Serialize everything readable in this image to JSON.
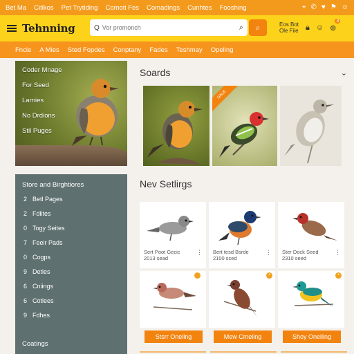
{
  "topbar": {
    "links": [
      "Bet Ma",
      "Citlkos",
      "Pet Trytiding",
      "Comoti Fes",
      "Comadings",
      "Cunhtes",
      "Fooshing"
    ],
    "icons": [
      "pin-icon",
      "phone-icon",
      "heart-icon",
      "flag-icon",
      "account-icon"
    ]
  },
  "header": {
    "logo": "Tehnning",
    "search": {
      "placeholder": "Vor promonch"
    },
    "account_text": "Eos Bot Ole Fiie",
    "cart_count": "3"
  },
  "nav": {
    "items": [
      "Fncie",
      "A Mies",
      "Sted Fopdes",
      "Conptany",
      "Fades",
      "Teshmay",
      "Opeling"
    ]
  },
  "hero": {
    "menu": [
      "Coder Mnage",
      "For Seed",
      "Larnies",
      "No Drdions",
      "Stil Puges"
    ]
  },
  "sidebar": {
    "title": "Store and Birghtiores",
    "items": [
      {
        "count": "2",
        "label": "Betl Pages"
      },
      {
        "count": "2",
        "label": "Fdlites"
      },
      {
        "count": "0",
        "label": "Togy Seites"
      },
      {
        "count": "7",
        "label": "Feeir Pads"
      },
      {
        "count": "0",
        "label": "Cogps"
      },
      {
        "count": "9",
        "label": "Detles"
      },
      {
        "count": "6",
        "label": "Cniings"
      },
      {
        "count": "6",
        "label": "Cotlees"
      },
      {
        "count": "9",
        "label": "Fdhes"
      }
    ],
    "footer": "Coatings"
  },
  "featured": {
    "title": "Soards",
    "ribbon": "SALE"
  },
  "new_settings": {
    "title": "Nev Setlirgs",
    "cards": [
      {
        "name": "Sert Poot Gecic\n2013 sead",
        "more": "⋮"
      },
      {
        "name": "Bert tesd Bsrde\n2100 sced",
        "more": "⋮"
      },
      {
        "name": "Ster Dock Seed\n2310 seed",
        "more": "⋮"
      }
    ],
    "buttons": [
      "Stsrr Oneilng",
      "Mew Cmeling",
      "Shoy Oneiling"
    ]
  },
  "colors": {
    "accent": "#f2830f",
    "header": "#fdd21a",
    "topbar": "#f39a1c",
    "sidebar": "#5f7070"
  }
}
